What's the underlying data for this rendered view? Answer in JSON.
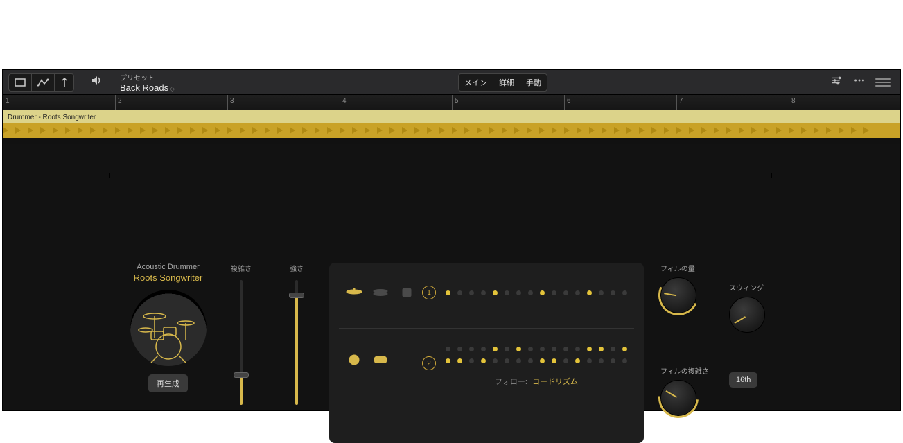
{
  "toolbar": {
    "preset_label": "プリセット",
    "preset_name": "Back Roads",
    "tabs": {
      "main": "メイン",
      "detail": "詳細",
      "manual": "手動"
    }
  },
  "region": {
    "name": "Drummer - Roots Songwriter"
  },
  "ruler": {
    "bars": [
      "1",
      "2",
      "3",
      "4",
      "5",
      "6",
      "7",
      "8"
    ]
  },
  "drummer": {
    "category": "Acoustic Drummer",
    "style": "Roots Songwriter",
    "regen": "再生成"
  },
  "sliders": {
    "complexity_label": "複雑さ",
    "complexity_value": 24,
    "intensity_label": "強さ",
    "intensity_value": 88
  },
  "pattern": {
    "row1_num": "1",
    "row2_num": "2",
    "follow_label": "フォロー:",
    "follow_value": "コードリズム"
  },
  "knobs": {
    "fill_amount": "フィルの量",
    "fill_complexity": "フィルの複雑さ",
    "swing": "スウィング",
    "swing_mode": "16th"
  }
}
